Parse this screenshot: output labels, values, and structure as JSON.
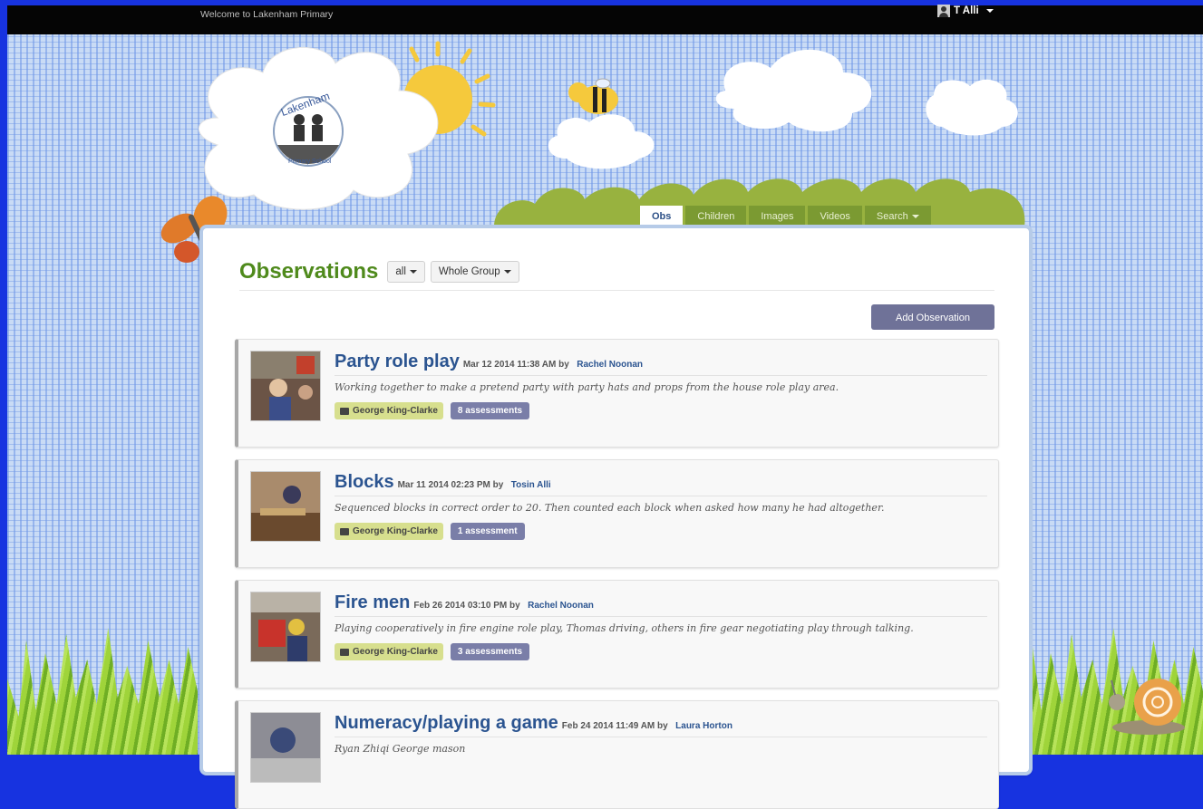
{
  "topbar": {
    "welcome": "Welcome to Lakenham Primary",
    "user": "T Alli"
  },
  "logo": {
    "name": "Lakenham",
    "subtitle": "Primary School"
  },
  "nav": {
    "tabs": [
      {
        "label": "Obs",
        "active": true
      },
      {
        "label": "Children"
      },
      {
        "label": "Images"
      },
      {
        "label": "Videos"
      },
      {
        "label": "Search"
      }
    ]
  },
  "page": {
    "title": "Observations",
    "filter_period": "all",
    "filter_group": "Whole Group",
    "add_button": "Add Observation"
  },
  "observations": [
    {
      "title": "Party role play",
      "date": "Mar 12 2014 11:38 AM by",
      "author": "Rachel Noonan",
      "desc": "Working together to make a pretend party with party hats and props from the house role play area.",
      "child": "George King-Clarke",
      "assessments": "8 assessments"
    },
    {
      "title": "Blocks",
      "date": "Mar 11 2014 02:23 PM by",
      "author": "Tosin Alli",
      "desc": "Sequenced blocks in correct order to 20. Then counted each block when asked how many he had altogether.",
      "child": "George King-Clarke",
      "assessments": "1 assessment"
    },
    {
      "title": "Fire men",
      "date": "Feb 26 2014 03:10 PM by",
      "author": "Rachel Noonan",
      "desc": "Playing cooperatively in fire engine role play, Thomas driving, others in fire gear negotiating play through talking.",
      "child": "George King-Clarke",
      "assessments": "3 assessments"
    },
    {
      "title": "Numeracy/playing a game",
      "date": "Feb 24 2014 11:49 AM by",
      "author": "Laura Horton",
      "desc": "Ryan Zhiqi George mason"
    }
  ],
  "colors": {
    "accent_green": "#4f8a1c",
    "link_blue": "#2b5490",
    "button": "#6f7298",
    "child_tag": "#d7df8e",
    "assessment_tag": "#7a7ea8"
  }
}
